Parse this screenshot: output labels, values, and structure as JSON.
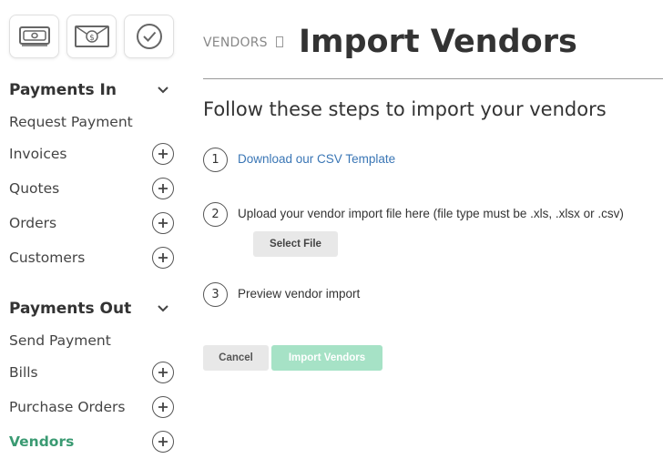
{
  "sidebar": {
    "icons": [
      "cash-icon",
      "money-envelope-icon",
      "checkmark-icon"
    ],
    "payments_in": {
      "title": "Payments In",
      "items": [
        {
          "label": "Request Payment",
          "has_add": false
        },
        {
          "label": "Invoices",
          "has_add": true
        },
        {
          "label": "Quotes",
          "has_add": true
        },
        {
          "label": "Orders",
          "has_add": true
        },
        {
          "label": "Customers",
          "has_add": true
        }
      ]
    },
    "payments_out": {
      "title": "Payments Out",
      "items": [
        {
          "label": "Send Payment",
          "has_add": false
        },
        {
          "label": "Bills",
          "has_add": true
        },
        {
          "label": "Purchase Orders",
          "has_add": true
        },
        {
          "label": "Vendors",
          "has_add": true,
          "active": true
        }
      ]
    }
  },
  "header": {
    "breadcrumb": "VENDORS",
    "title": "Import Vendors"
  },
  "main": {
    "subtitle": "Follow these steps to import your vendors",
    "steps": [
      {
        "number": "1",
        "text": "Download our CSV Template"
      },
      {
        "number": "2",
        "text": "Upload your vendor import file here (file type must be .xls, .xlsx or .csv)"
      },
      {
        "number": "3",
        "text": "Preview vendor import"
      }
    ],
    "select_file_label": "Select File",
    "cancel_label": "Cancel",
    "import_label": "Import Vendors"
  },
  "colors": {
    "accent": "#3a9a72",
    "link": "#3a76b5",
    "import_button_disabled": "#a6e2c6"
  }
}
